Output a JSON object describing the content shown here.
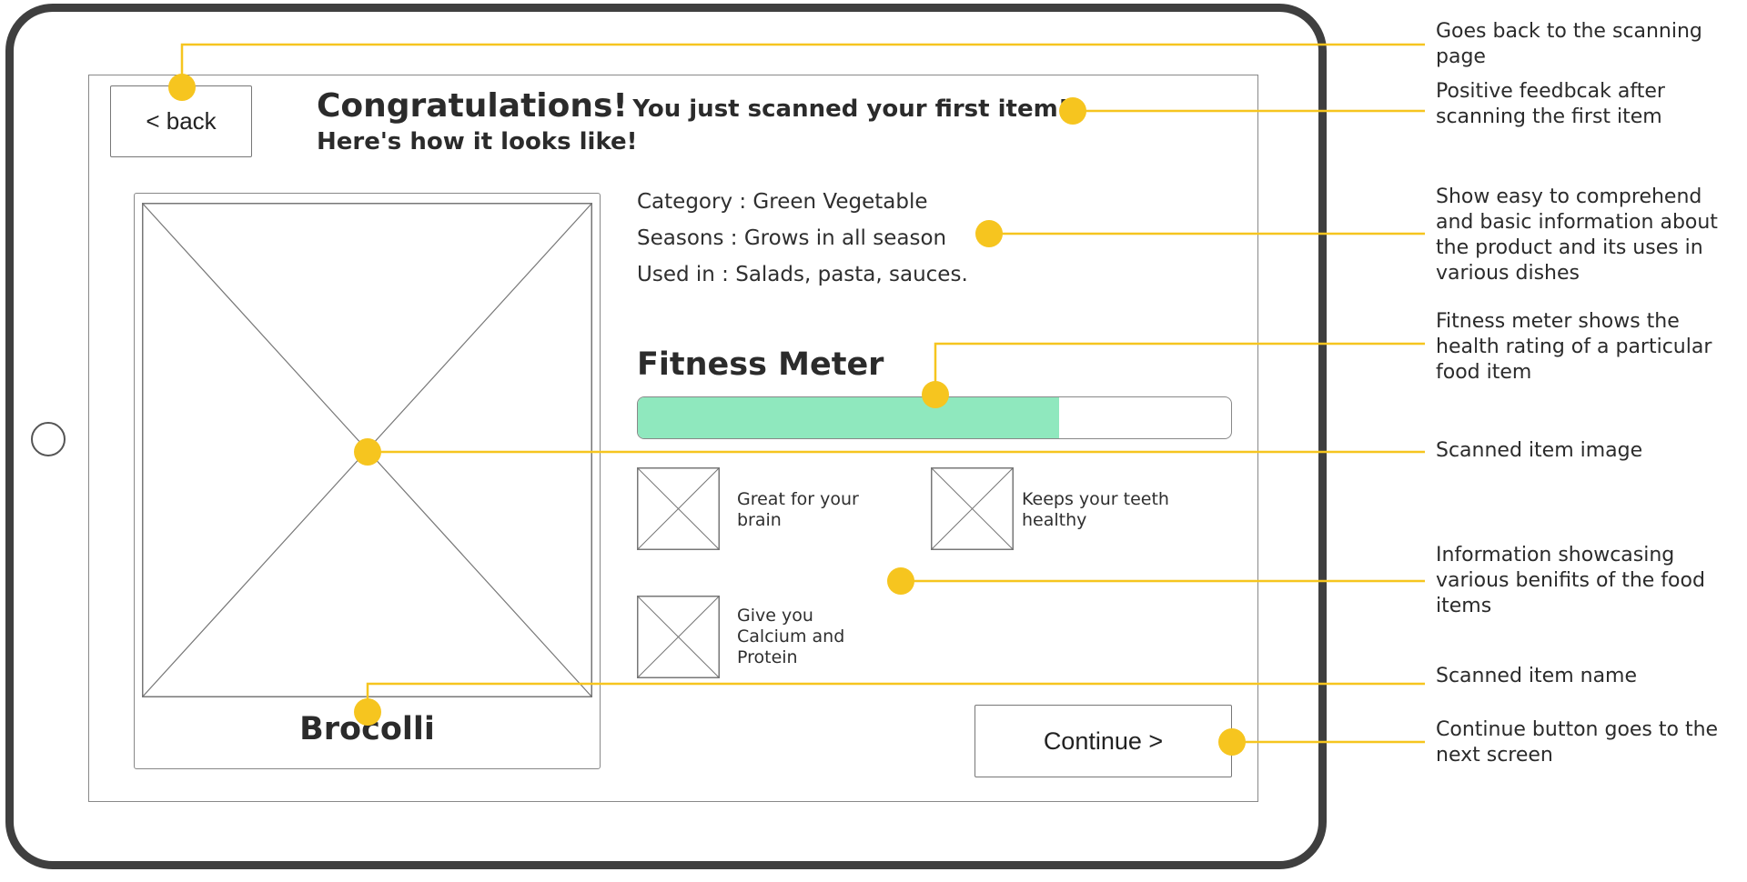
{
  "screen": {
    "back_label": "< back",
    "title_big": "Congratulations!",
    "title_small": "You just scanned your first item!",
    "title_line2": "Here's how it looks like!",
    "item_name": "Brocolli",
    "info": {
      "category": "Category : Green Vegetable",
      "seasons": "Seasons : Grows in all season",
      "used_in": "Used in : Salads, pasta, sauces."
    },
    "meter": {
      "title": "Fitness Meter",
      "level": 0.71,
      "fill_color": "#8fe8be"
    },
    "benefits": [
      {
        "text": "Great for your brain"
      },
      {
        "text": "Keeps your teeth healthy"
      },
      {
        "text": "Give you Calcium and Protein"
      }
    ],
    "continue_label": "Continue >"
  },
  "annotations": [
    {
      "text": "Goes back to the scanning page"
    },
    {
      "text": "Positive feedbcak after scanning the first item"
    },
    {
      "text": "Show easy to comprehend and basic information about the product and its uses in various dishes"
    },
    {
      "text": "Fitness meter shows the health rating of a particular food item"
    },
    {
      "text": "Scanned item image"
    },
    {
      "text": "Information showcasing various benifits of the food items"
    },
    {
      "text": "Scanned item name"
    },
    {
      "text": "Continue button goes to the next screen"
    }
  ],
  "colors": {
    "callout": "#f6c51f",
    "frame": "#3f3f3f"
  }
}
